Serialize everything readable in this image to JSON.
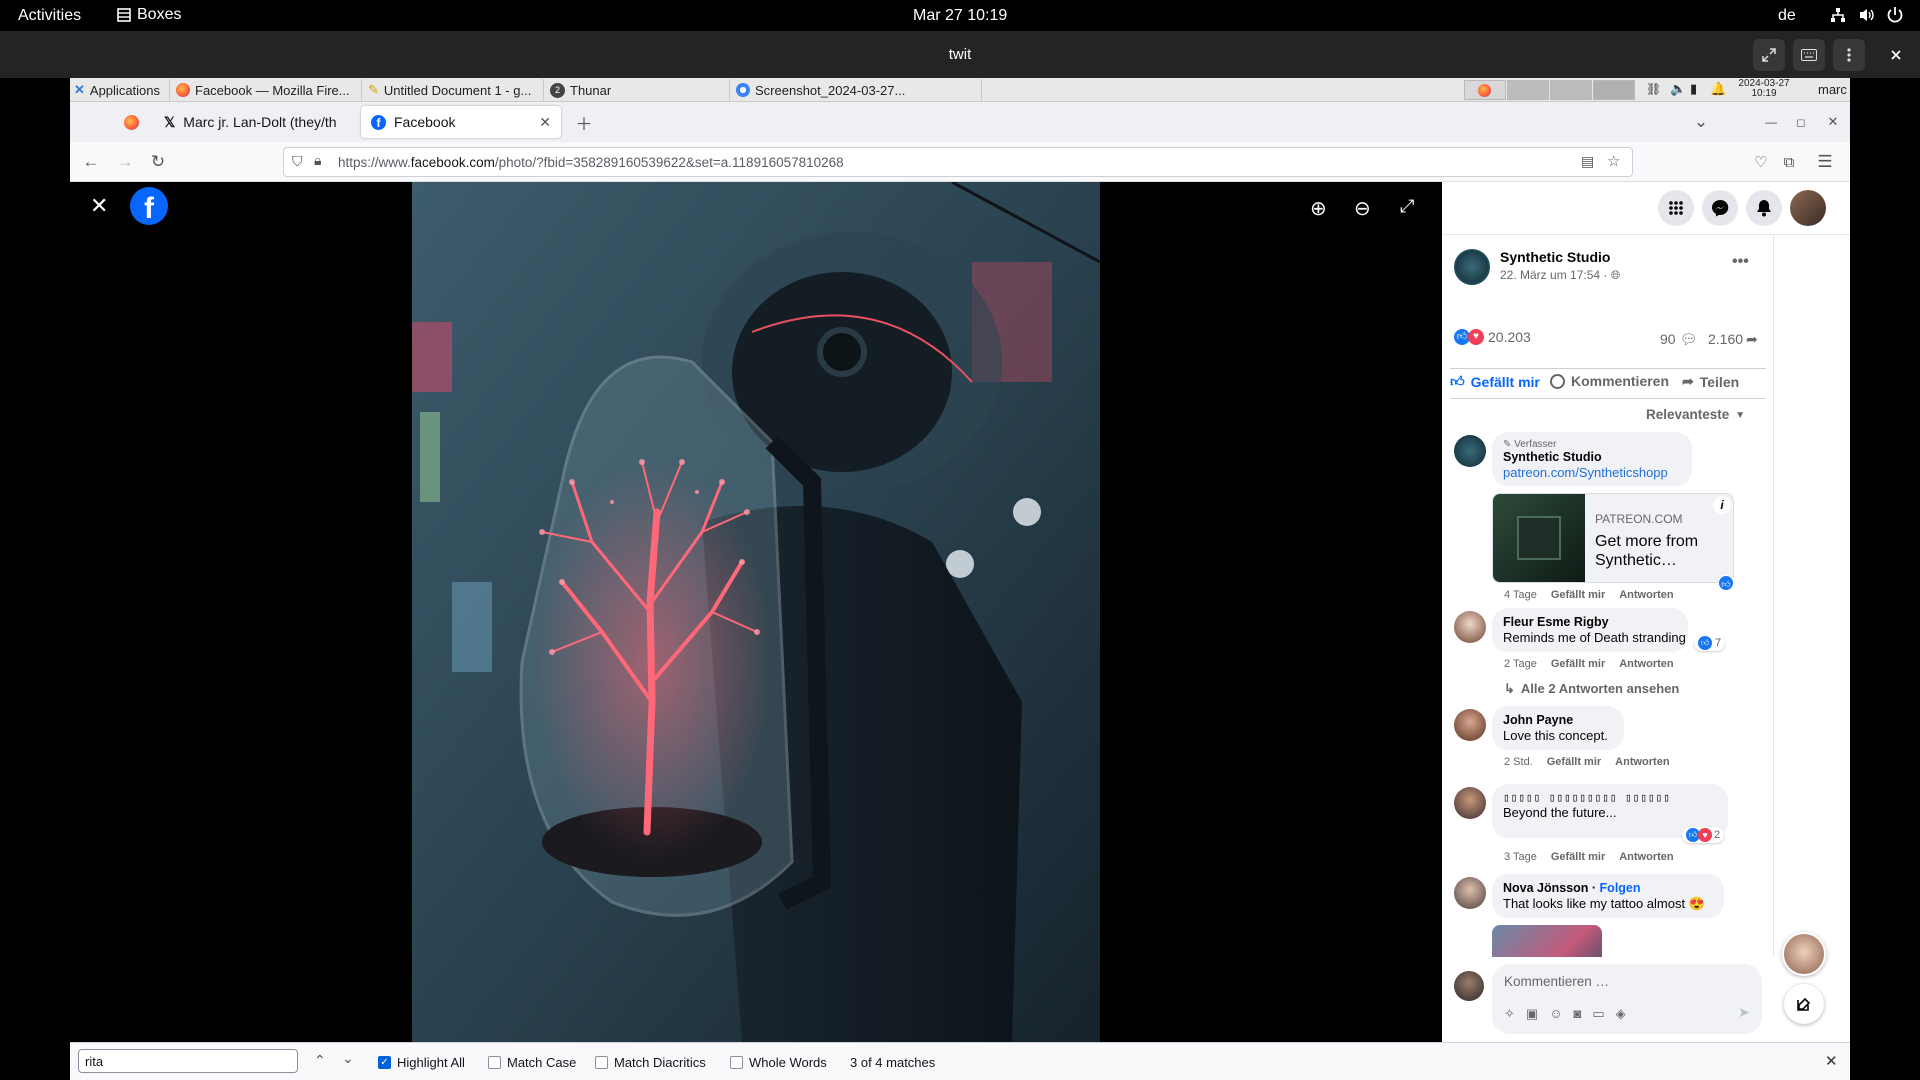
{
  "gnome_bar": {
    "activities": "Activities",
    "app_name": "Boxes",
    "clock": "Mar 27  10:19",
    "keyboard_layout": "de"
  },
  "boxes": {
    "title": "twit"
  },
  "xfce_panel": {
    "applications": "Applications",
    "tasks": [
      {
        "label": "Facebook — Mozilla Fire..."
      },
      {
        "label": "Untitled Document 1 - g..."
      },
      {
        "label": "Thunar"
      },
      {
        "label": "Screenshot_2024-03-27..."
      }
    ],
    "thunar_badge": "2",
    "clock_date": "2024-03-27",
    "clock_time": "10:19",
    "user": "marc"
  },
  "firefox": {
    "tabs": [
      {
        "label": "Marc jr. Lan-Dolt (they/th"
      },
      {
        "label": "Facebook"
      }
    ],
    "url_prefix": "https://www.",
    "url_domain": "facebook.com",
    "url_rest": "/photo/?fbid=358289160539622&set=a.118916057810268"
  },
  "post": {
    "page_name": "Synthetic Studio",
    "date": "22. März um 17:54 ·",
    "reactions_count": "20.203",
    "comments_count": "90",
    "shares_count": "2.160",
    "like_label": "Gefällt mir",
    "comment_label": "Kommentieren",
    "share_label": "Teilen",
    "sort_label": "Relevanteste"
  },
  "comments": [
    {
      "author_tag": "Verfasser",
      "name": "Synthetic Studio",
      "link": "patreon.com/Syntheticshopp",
      "card_domain": "PATREON.COM",
      "card_title": "Get more from Synthetic…",
      "time": "4 Tage",
      "like": "Gefällt mir",
      "reply": "Antworten"
    },
    {
      "name": "Fleur Esme Rigby",
      "text": "Reminds me of Death stranding",
      "reaction_count": "7",
      "time": "2 Tage",
      "like": "Gefällt mir",
      "reply": "Antworten",
      "view_replies": "Alle 2 Antworten ansehen"
    },
    {
      "name": "John Payne",
      "text": "Love this concept.",
      "time": "2 Std.",
      "like": "Gefällt mir",
      "reply": "Antworten"
    },
    {
      "name": "▯▯▯▯▯ ▯▯▯▯▯▯▯▯▯ ▯▯▯▯▯▯",
      "text": "Beyond the future...",
      "reaction_count": "2",
      "time": "3 Tage",
      "like": "Gefällt mir",
      "reply": "Antworten"
    },
    {
      "name": "Nova Jönsson",
      "follow": "Folgen",
      "text": "That looks like my tattoo almost 😍"
    }
  ],
  "composer": {
    "placeholder": "Kommentieren …"
  },
  "findbar": {
    "query": "rita",
    "highlight_all": "Highlight All",
    "match_case": "Match Case",
    "match_diacritics": "Match Diacritics",
    "whole_words": "Whole Words",
    "status": "3 of 4 matches",
    "highlight_checked": true
  },
  "colors": {
    "fb_blue": "#0866ff",
    "link_blue": "#216fdb",
    "find_accent": "#0061e0"
  }
}
